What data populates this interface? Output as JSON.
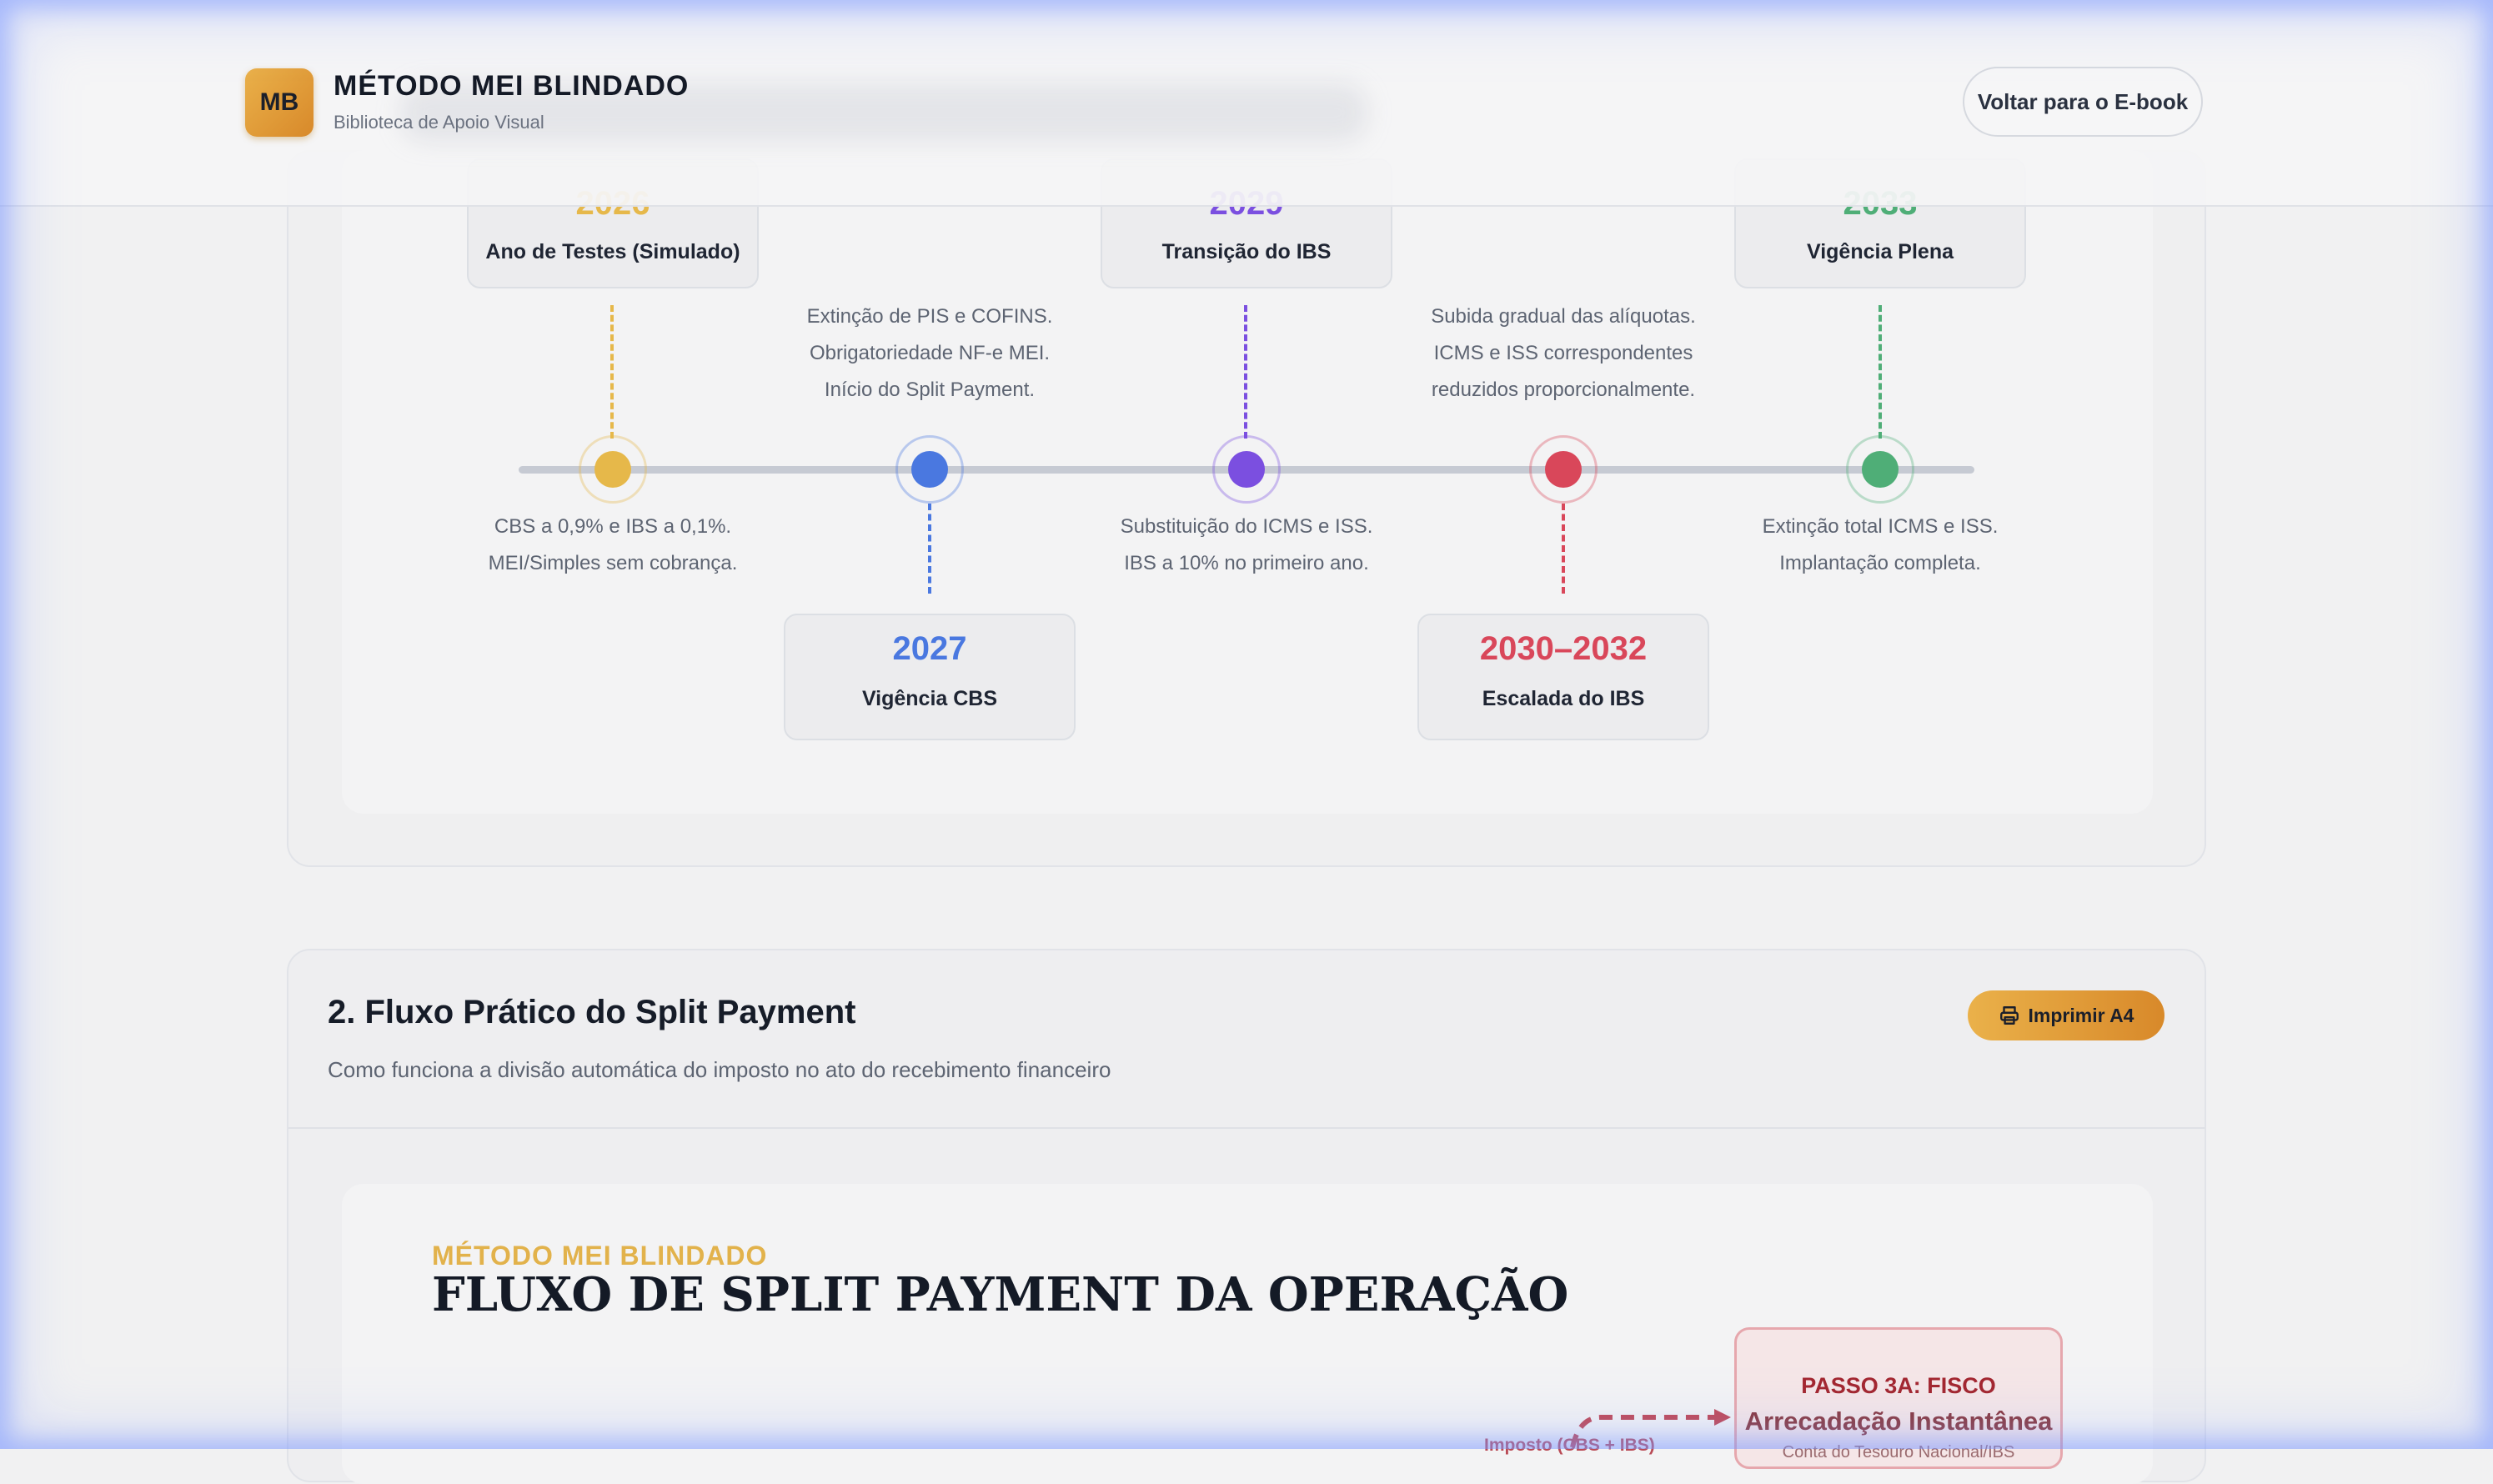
{
  "header": {
    "logo": "MB",
    "title": "MÉTODO MEI BLINDADO",
    "subtitle": "Biblioteca de Apoio Visual",
    "back_button": "Voltar para o E-book"
  },
  "timeline": {
    "milestones": [
      {
        "year": "2026",
        "label": "Ano de Testes (Simulado)",
        "description": [
          "CBS a 0,9% e IBS a 0,1%.",
          "MEI/Simples sem cobrança."
        ],
        "color": "#e6b84a"
      },
      {
        "year": "2027",
        "label": "Vigência CBS",
        "description": [
          "Extinção de PIS e COFINS.",
          "Obrigatoriedade NF-e MEI.",
          "Início do Split Payment."
        ],
        "color": "#4a78e0"
      },
      {
        "year": "2029",
        "label": "Transição do IBS",
        "description": [
          "Substituição do ICMS e ISS.",
          "IBS a 10% no primeiro ano."
        ],
        "color": "#7b4fe0"
      },
      {
        "year": "2030–2032",
        "label": "Escalada do IBS",
        "description": [
          "Subida gradual das alíquotas.",
          "ICMS e ISS correspondentes",
          "reduzidos proporcionalmente."
        ],
        "color": "#d9475a"
      },
      {
        "year": "2033",
        "label": "Vigência Plena",
        "description": [
          "Extinção total ICMS e ISS.",
          "Implantação completa."
        ],
        "color": "#4fae77"
      }
    ]
  },
  "section2": {
    "title": "2. Fluxo Prático do Split Payment",
    "subtitle": "Como funciona a divisão automática do imposto no ato do recebimento financeiro",
    "print_button": "Imprimir A4",
    "kicker": "MÉTODO MEI BLINDADO",
    "heading": "FLUXO DE SPLIT PAYMENT DA OPERAÇÃO",
    "fisco": {
      "step": "PASSO 3A: FISCO",
      "name": "Arrecadação Instantânea",
      "small": "Conta do Tesouro Nacional/IBS"
    },
    "arrow_label": "Imposto (CBS + IBS)"
  }
}
